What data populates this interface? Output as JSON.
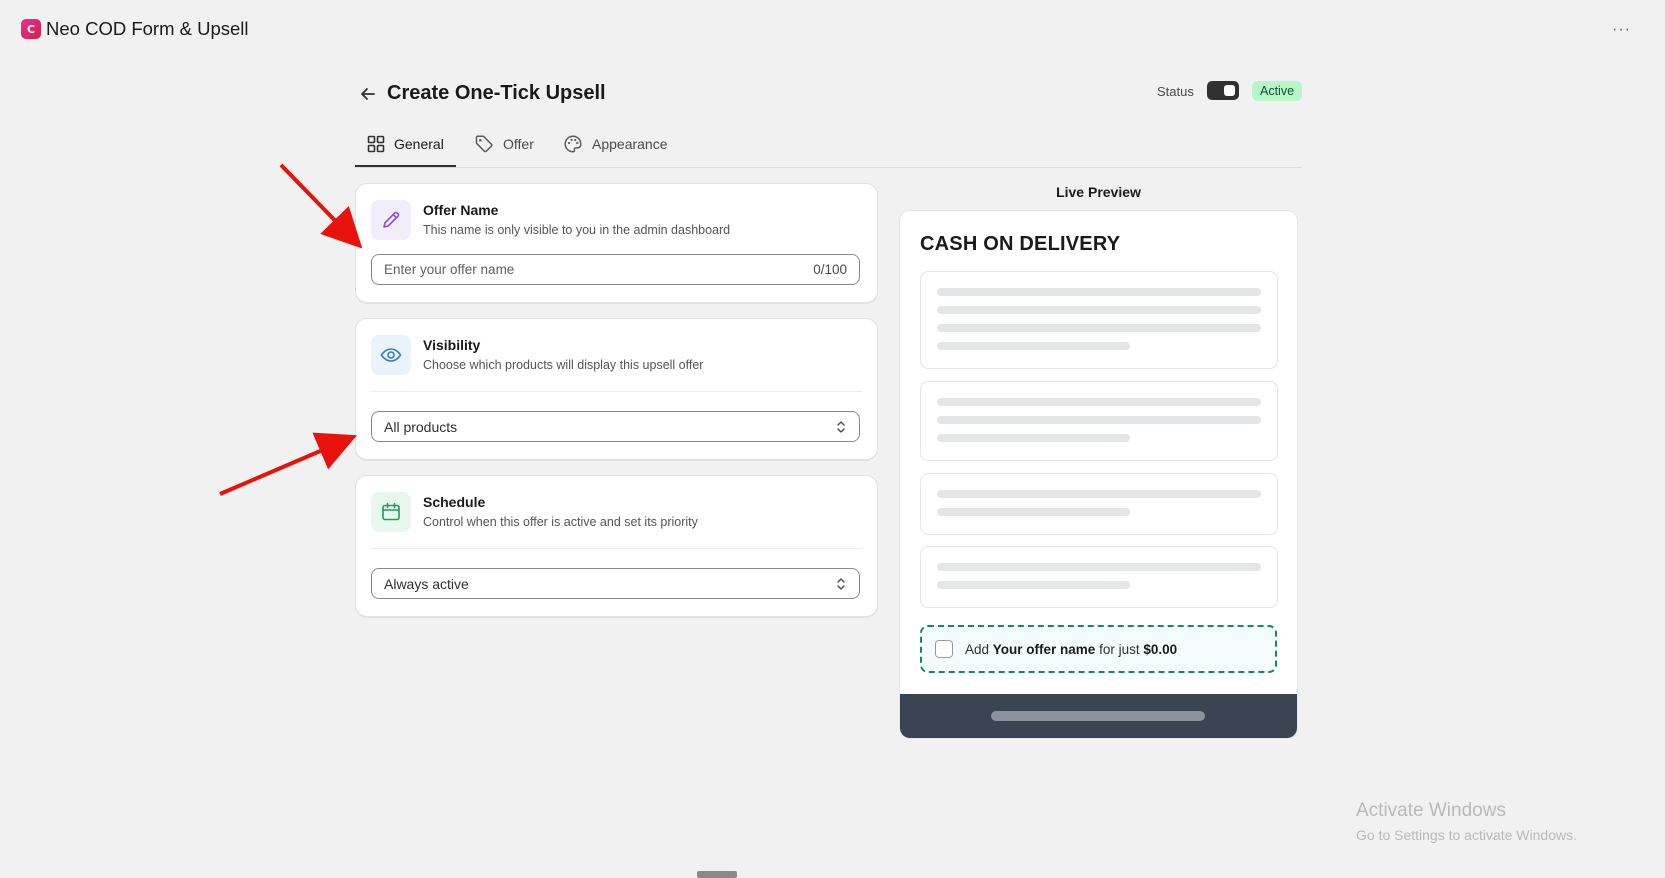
{
  "app": {
    "logo_text": "C",
    "title": "Neo COD Form & Upsell",
    "more_label": "···"
  },
  "header": {
    "title": "Create One-Tick Upsell",
    "status_label": "Status",
    "status_badge": "Active",
    "status_on": true
  },
  "tabs": [
    {
      "label": "General",
      "icon": "grid-icon",
      "active": true
    },
    {
      "label": "Offer",
      "icon": "tag-icon",
      "active": false
    },
    {
      "label": "Appearance",
      "icon": "palette-icon",
      "active": false
    }
  ],
  "offer_name": {
    "title": "Offer Name",
    "subtitle": "This name is only visible to you in the admin dashboard",
    "placeholder": "Enter your offer name",
    "value": "",
    "counter": "0/100",
    "icon": "pencil-icon"
  },
  "visibility": {
    "title": "Visibility",
    "subtitle": "Choose which products will display this upsell offer",
    "selected": "All products",
    "icon": "eye-icon"
  },
  "schedule": {
    "title": "Schedule",
    "subtitle": "Control when this offer is active and set its priority",
    "selected": "Always active",
    "icon": "calendar-icon"
  },
  "preview": {
    "label": "Live Preview",
    "heading": "CASH ON DELIVERY",
    "offer_prefix": "Add",
    "offer_name": "Your offer name",
    "offer_mid": "for just",
    "offer_price": "$0.00"
  },
  "watermark": {
    "line1": "Activate Windows",
    "line2": "Go to Settings to activate Windows."
  },
  "colors": {
    "badge_bg": "#b8f5c8",
    "offer_border": "#128a5a",
    "preview_footer": "#3b4452",
    "annotation_arrow": "#e8120c"
  }
}
